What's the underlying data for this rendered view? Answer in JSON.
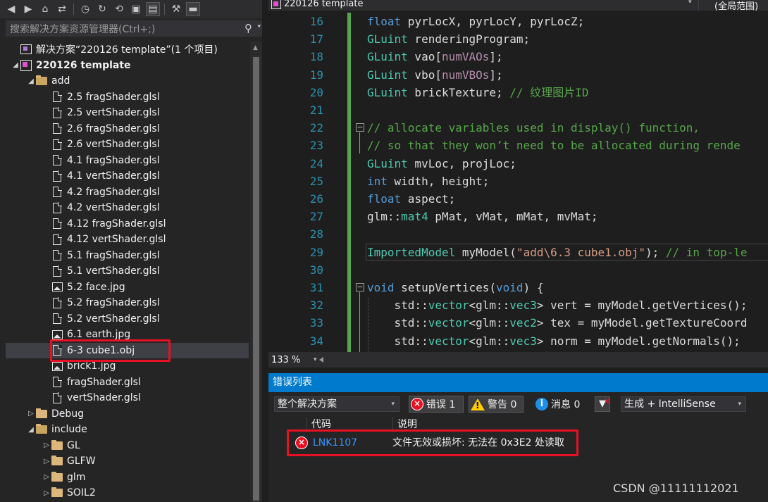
{
  "explorer": {
    "search_placeholder": "搜索解决方案资源管理器(Ctrl+;)",
    "toolbar_icons": [
      "back-icon",
      "forward-icon",
      "home-icon",
      "sync-icon",
      "history-icon",
      "refresh-icon",
      "undo-icon",
      "collapse-icon",
      "show-all-icon",
      "properties-icon",
      "preview-icon"
    ],
    "tree": [
      {
        "label": "解决方案“220126 template”(1 个项目)",
        "kind": "solution",
        "depth": 0,
        "arrow": "",
        "bold": false
      },
      {
        "label": "220126 template",
        "kind": "project",
        "depth": 0,
        "arrow": "◢",
        "bold": true
      },
      {
        "label": "add",
        "kind": "folder-open",
        "depth": 1,
        "arrow": "◢",
        "bold": false
      },
      {
        "label": "2.5 fragShader.glsl",
        "kind": "file",
        "depth": 2,
        "arrow": "",
        "bold": false
      },
      {
        "label": "2.5 vertShader.glsl",
        "kind": "file",
        "depth": 2,
        "arrow": "",
        "bold": false
      },
      {
        "label": "2.6 fragShader.glsl",
        "kind": "file",
        "depth": 2,
        "arrow": "",
        "bold": false
      },
      {
        "label": "2.6 vertShader.glsl",
        "kind": "file",
        "depth": 2,
        "arrow": "",
        "bold": false
      },
      {
        "label": "4.1 fragShader.glsl",
        "kind": "file",
        "depth": 2,
        "arrow": "",
        "bold": false
      },
      {
        "label": "4.1 vertShader.glsl",
        "kind": "file",
        "depth": 2,
        "arrow": "",
        "bold": false
      },
      {
        "label": "4.2 fragShader.glsl",
        "kind": "file",
        "depth": 2,
        "arrow": "",
        "bold": false
      },
      {
        "label": "4.2 vertShader.glsl",
        "kind": "file",
        "depth": 2,
        "arrow": "",
        "bold": false
      },
      {
        "label": "4.12 fragShader.glsl",
        "kind": "file",
        "depth": 2,
        "arrow": "",
        "bold": false
      },
      {
        "label": "4.12 vertShader.glsl",
        "kind": "file",
        "depth": 2,
        "arrow": "",
        "bold": false
      },
      {
        "label": "5.1 fragShader.glsl",
        "kind": "file",
        "depth": 2,
        "arrow": "",
        "bold": false
      },
      {
        "label": "5.1 vertShader.glsl",
        "kind": "file",
        "depth": 2,
        "arrow": "",
        "bold": false
      },
      {
        "label": "5.2 face.jpg",
        "kind": "image",
        "depth": 2,
        "arrow": "",
        "bold": false
      },
      {
        "label": "5.2 fragShader.glsl",
        "kind": "file",
        "depth": 2,
        "arrow": "",
        "bold": false
      },
      {
        "label": "5.2 vertShader.glsl",
        "kind": "file",
        "depth": 2,
        "arrow": "",
        "bold": false
      },
      {
        "label": "6.1 earth.jpg",
        "kind": "image",
        "depth": 2,
        "arrow": "",
        "bold": false
      },
      {
        "label": "6-3 cube1.obj",
        "kind": "file",
        "depth": 2,
        "arrow": "",
        "bold": false,
        "selected": true
      },
      {
        "label": "brick1.jpg",
        "kind": "image",
        "depth": 2,
        "arrow": "",
        "bold": false
      },
      {
        "label": "fragShader.glsl",
        "kind": "file",
        "depth": 2,
        "arrow": "",
        "bold": false
      },
      {
        "label": "vertShader.glsl",
        "kind": "file",
        "depth": 2,
        "arrow": "",
        "bold": false
      },
      {
        "label": "Debug",
        "kind": "folder",
        "depth": 1,
        "arrow": "▷",
        "bold": false
      },
      {
        "label": "include",
        "kind": "folder-open",
        "depth": 1,
        "arrow": "◢",
        "bold": false
      },
      {
        "label": "GL",
        "kind": "folder",
        "depth": 2,
        "arrow": "▷",
        "bold": false
      },
      {
        "label": "GLFW",
        "kind": "folder",
        "depth": 2,
        "arrow": "▷",
        "bold": false
      },
      {
        "label": "glm",
        "kind": "folder",
        "depth": 2,
        "arrow": "▷",
        "bold": false
      },
      {
        "label": "SOIL2",
        "kind": "folder",
        "depth": 2,
        "arrow": "▷",
        "bold": false
      }
    ]
  },
  "editor": {
    "nav_project": "220126 template",
    "nav_scope": "(全局范围)",
    "lines": [
      {
        "n": "16",
        "html": "<span class=\"kw\">float</span> pyrLocX, pyrLocY, pyrLocZ;"
      },
      {
        "n": "17",
        "html": "<span class=\"ty\">GLuint</span> renderingProgram;"
      },
      {
        "n": "18",
        "html": "<span class=\"ty\">GLuint</span> vao[<span class=\"mac\">numVAOs</span>];"
      },
      {
        "n": "19",
        "html": "<span class=\"ty\">GLuint</span> vbo[<span class=\"mac\">numVBOs</span>];"
      },
      {
        "n": "20",
        "html": "<span class=\"ty\">GLuint</span> brickTexture; <span class=\"cm\">// 纹理图片ID</span>"
      },
      {
        "n": "21",
        "html": ""
      },
      {
        "n": "22",
        "html": "<span class=\"cm\">// allocate variables used in display() function,</span>"
      },
      {
        "n": "23",
        "html": "<span class=\"cm\">// so that they won’t need to be allocated during rende</span>"
      },
      {
        "n": "24",
        "html": "<span class=\"ty\">GLuint</span> mvLoc, projLoc;"
      },
      {
        "n": "25",
        "html": "<span class=\"kw\">int</span> width, height;"
      },
      {
        "n": "26",
        "html": "<span class=\"kw\">float</span> aspect;"
      },
      {
        "n": "27",
        "html": "glm::<span class=\"ty\">mat4</span> pMat, vMat, mMat, mvMat;"
      },
      {
        "n": "28",
        "html": ""
      },
      {
        "n": "29",
        "html": "<span class=\"ty\">ImportedModel</span> myModel(<span class=\"st\">\"add\\6.3 cube1.obj\"</span>); <span class=\"cm\">// in top-le</span>"
      },
      {
        "n": "30",
        "html": ""
      },
      {
        "n": "31",
        "html": "<span class=\"kw\">void</span> setupVertices(<span class=\"kw\">void</span>) {"
      },
      {
        "n": "32",
        "html": "    std::<span class=\"tp\">vector</span>&lt;glm::<span class=\"tp\">vec3</span>&gt; vert = myModel.getVertices();"
      },
      {
        "n": "33",
        "html": "    std::<span class=\"tp\">vector</span>&lt;glm::<span class=\"tp\">vec2</span>&gt; tex = myModel.getTextureCoord"
      },
      {
        "n": "34",
        "html": "    std::<span class=\"tp\">vector</span>&lt;glm::<span class=\"tp\">vec3</span>&gt; norm = myModel.getNormals();"
      }
    ],
    "zoom": "133 %"
  },
  "error_list": {
    "title": "错误列表",
    "scope": "整个解决方案",
    "errors_label": "错误 1",
    "warnings_label": "警告 0",
    "messages_label": "消息 0",
    "build_filter": "生成 + IntelliSense",
    "columns": {
      "code": "代码",
      "description": "说明"
    },
    "rows": [
      {
        "code": "LNK1107",
        "description": "文件无效或损坏: 无法在 0x3E2 处读取"
      }
    ]
  },
  "watermark": "CSDN @11111112021",
  "colors": {
    "accent": "#007acc",
    "error": "#e81123",
    "selection": "#3f3f46",
    "highlight_box": "#e81123"
  }
}
